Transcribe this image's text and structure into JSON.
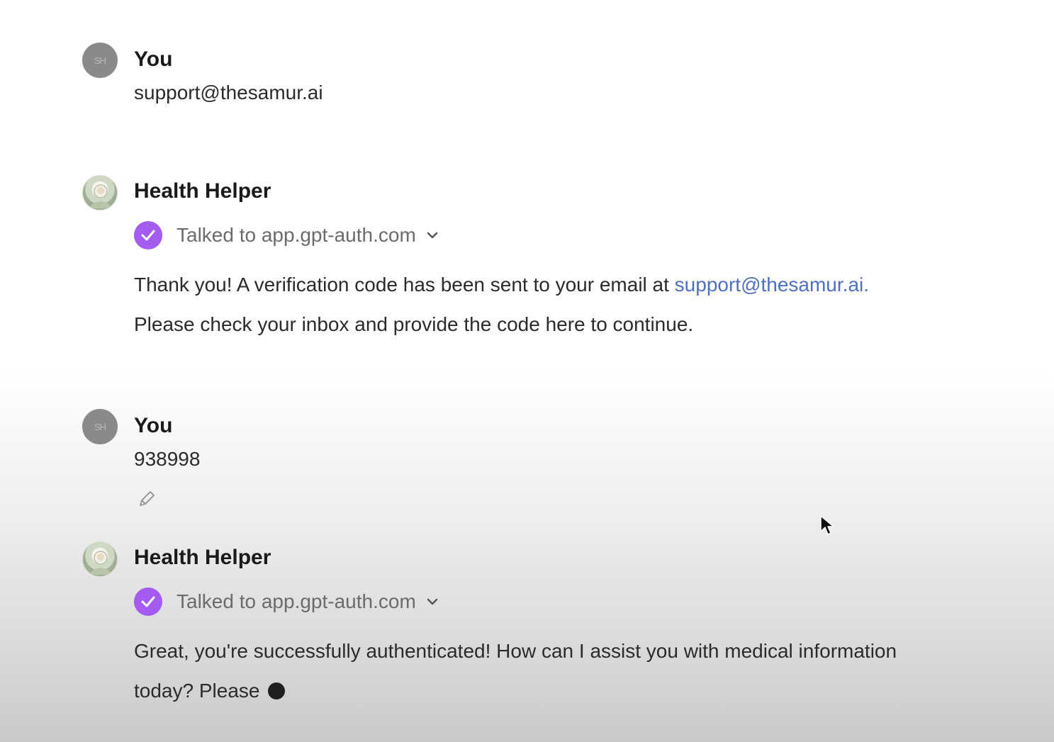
{
  "messages": [
    {
      "author": "You",
      "avatar_initials": "SH",
      "text": "support@thesamur.ai"
    },
    {
      "author": "Health Helper",
      "tool_label": "Talked to app.gpt-auth.com",
      "line1_prefix": "Thank you! A verification code has been sent to your email at ",
      "line1_link": "support@thesamur.ai",
      "line1_suffix": ".",
      "line2": "Please check your inbox and provide the code here to continue."
    },
    {
      "author": "You",
      "avatar_initials": "SH",
      "text": "938998"
    },
    {
      "author": "Health Helper",
      "tool_label": "Talked to app.gpt-auth.com",
      "line1": "Great, you're successfully authenticated! How can I assist you with medical information",
      "line2": "today? Please"
    }
  ],
  "icons": {
    "check": "check-icon",
    "chevron": "chevron-down-icon",
    "edit": "pencil-icon",
    "cursor": "mouse-cursor-icon"
  },
  "colors": {
    "accent_purple": "#a35bf0",
    "link_blue": "#4f6fc0"
  }
}
